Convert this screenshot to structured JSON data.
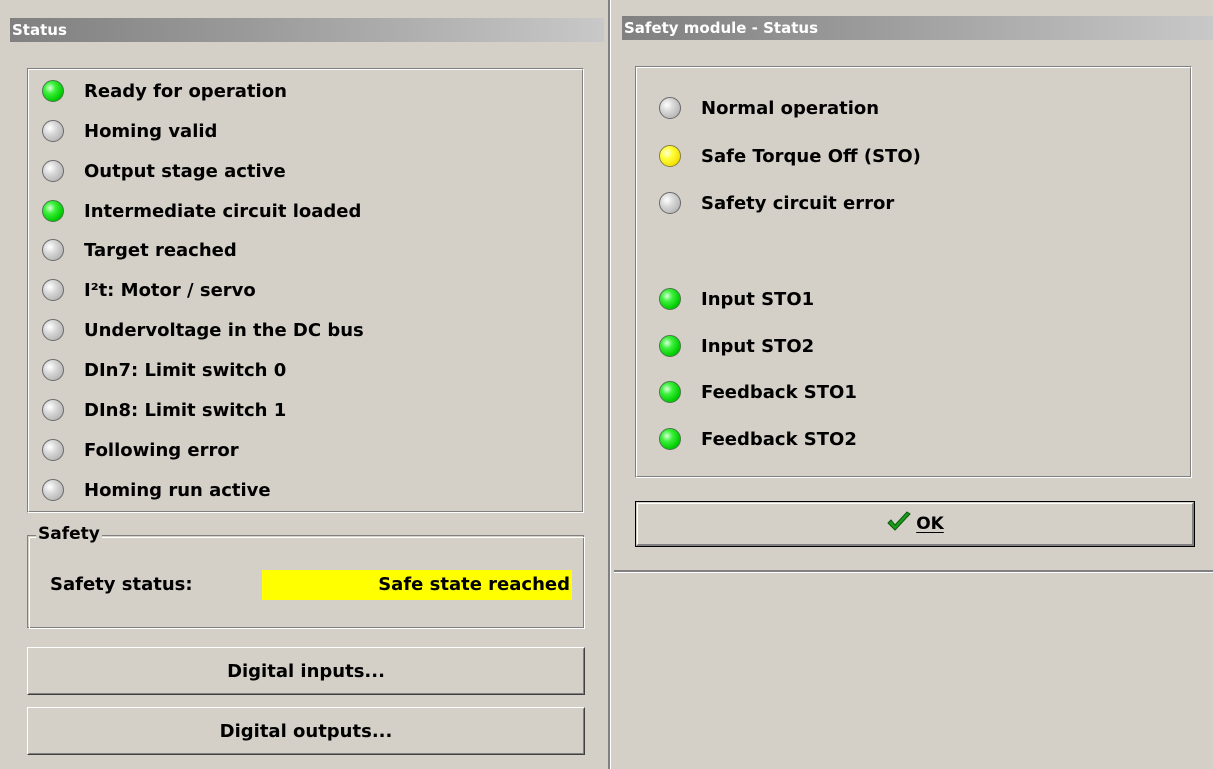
{
  "left": {
    "title": "Status",
    "items": [
      {
        "label": "Ready for operation",
        "state": "green"
      },
      {
        "label": "Homing valid",
        "state": "grey"
      },
      {
        "label": "Output stage active",
        "state": "grey"
      },
      {
        "label": "Intermediate circuit loaded",
        "state": "green"
      },
      {
        "label": "Target reached",
        "state": "grey"
      },
      {
        "label": "I²t: Motor / servo",
        "state": "grey"
      },
      {
        "label": "Undervoltage in the DC bus",
        "state": "grey"
      },
      {
        "label": "DIn7: Limit switch 0",
        "state": "grey"
      },
      {
        "label": "DIn8: Limit switch 1",
        "state": "grey"
      },
      {
        "label": "Following error",
        "state": "grey"
      },
      {
        "label": "Homing run active",
        "state": "grey"
      }
    ],
    "safety": {
      "legend": "Safety",
      "status_label": "Safety status:",
      "status_value": "Safe state reached",
      "status_color": "#ffff00"
    },
    "buttons": {
      "digital_inputs": "Digital inputs...",
      "digital_outputs": "Digital outputs..."
    }
  },
  "right": {
    "title": "Safety module - Status",
    "items": [
      {
        "label": "Normal operation",
        "state": "grey"
      },
      {
        "label": "Safe Torque Off (STO)",
        "state": "yellow"
      },
      {
        "label": "Safety circuit error",
        "state": "grey"
      },
      {
        "label": "Input STO1",
        "state": "green"
      },
      {
        "label": "Input STO2",
        "state": "green"
      },
      {
        "label": "Feedback STO1",
        "state": "green"
      },
      {
        "label": "Feedback STO2",
        "state": "green"
      }
    ],
    "ok_button": {
      "label": "OK",
      "icon": "checkmark-icon"
    }
  },
  "colors": {
    "led_green": "#00cc00",
    "led_grey": "#c0c0c0",
    "led_yellow": "#ffff00",
    "window_bg": "#d4d0c8"
  }
}
